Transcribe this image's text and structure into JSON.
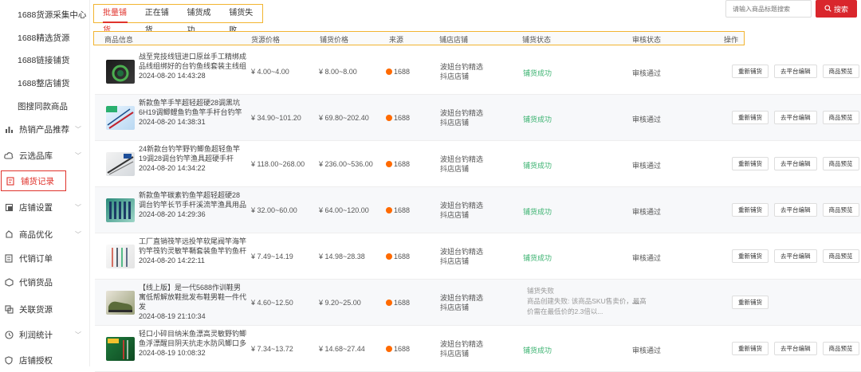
{
  "sidebar": {
    "sub_items": [
      {
        "label": "1688货源采集中心"
      },
      {
        "label": "1688精选货源"
      },
      {
        "label": "1688链接铺货"
      },
      {
        "label": "1688整店铺货"
      },
      {
        "label": "图搜同款商品"
      }
    ],
    "main_items": [
      {
        "label": "热销产品推荐",
        "icon": "bar-chart-icon",
        "chevron": true
      },
      {
        "label": "云选品库",
        "icon": "cloud-icon",
        "chevron": true
      },
      {
        "label": "铺货记录",
        "icon": "document-icon",
        "chevron": false,
        "active": true
      },
      {
        "label": "店铺设置",
        "icon": "store-icon",
        "chevron": true
      },
      {
        "label": "商品优化",
        "icon": "optimize-icon",
        "chevron": true
      },
      {
        "label": "代销订单",
        "icon": "order-icon",
        "chevron": false
      },
      {
        "label": "代销货品",
        "icon": "goods-icon",
        "chevron": false
      },
      {
        "label": "关联货源",
        "icon": "link-icon",
        "chevron": false
      },
      {
        "label": "利润统计",
        "icon": "clock-icon",
        "chevron": true
      },
      {
        "label": "店铺授权",
        "icon": "shield-icon",
        "chevron": false
      }
    ]
  },
  "tabs": [
    {
      "label": "批量铺货",
      "active": true
    },
    {
      "label": "正在铺货"
    },
    {
      "label": "铺货成功"
    },
    {
      "label": "铺货失败"
    }
  ],
  "search": {
    "placeholder": "请输入商品标题搜索",
    "button_label": "搜索"
  },
  "columns": [
    "商品信息",
    "货源价格",
    "铺货价格",
    "来源",
    "铺店店铺",
    "铺货状态",
    "审核状态",
    "操作"
  ],
  "buttons": {
    "republish": "重新铺货",
    "edit": "去平台编辑",
    "preview": "商品预览"
  },
  "rows": [
    {
      "title": "战至竞技线钮进口原丝手工精绑成品线组绑好的台钓鱼线套装主线组",
      "time": "2024-08-20 14:43:28",
      "source_price": "¥ 4.00~4.00",
      "list_price": "¥ 8.00~8.00",
      "source": "1688",
      "shop": "波妞台钓精选",
      "shop_type": "抖店店铺",
      "status": "铺货成功",
      "audit": "审核通过",
      "full_buttons": true
    },
    {
      "title": "新款鱼竿手竿超轻超硬28调黑坑6H19调鲫鲤鱼钓鱼竿手杆台钓竿",
      "time": "2024-08-20 14:38:31",
      "source_price": "¥ 34.90~101.20",
      "list_price": "¥ 69.80~202.40",
      "source": "1688",
      "shop": "波妞台钓精选",
      "shop_type": "抖店店铺",
      "status": "铺货成功",
      "audit": "审核通过",
      "full_buttons": true
    },
    {
      "title": "24新款台钓竿野钓鲫鱼超轻鱼竿19调28调台钓竿渔具超硬手杆",
      "time": "2024-08-20 14:34:22",
      "source_price": "¥ 118.00~268.00",
      "list_price": "¥ 236.00~536.00",
      "source": "1688",
      "shop": "波妞台钓精选",
      "shop_type": "抖店店铺",
      "status": "铺货成功",
      "audit": "审核通过",
      "full_buttons": true
    },
    {
      "title": "新款鱼竿碳素钓鱼竿超轻超硬28调台钓竿长节手杆溪流竿渔具用品",
      "time": "2024-08-20 14:29:36",
      "source_price": "¥ 32.00~60.00",
      "list_price": "¥ 64.00~120.00",
      "source": "1688",
      "shop": "波妞台钓精选",
      "shop_type": "抖店店铺",
      "status": "铺货成功",
      "audit": "审核通过",
      "full_buttons": true
    },
    {
      "title": "工厂直销筏竿远投竿软尾阀竿海竿钓竿筏钓灵敏竿鞘套装鱼竿钓鱼杆",
      "time": "2024-08-20 14:22:11",
      "source_price": "¥ 7.49~14.19",
      "list_price": "¥ 14.98~28.38",
      "source": "1688",
      "shop": "波妞台钓精选",
      "shop_type": "抖店店铺",
      "status": "铺货成功",
      "audit": "审核通过",
      "full_buttons": true
    },
    {
      "title": "【线上版】是一代5688作训鞋男寓低帮解放鞋批发布鞋男鞋一件代发",
      "time": "2024-08-19 21:10:34",
      "source_price": "¥ 4.60~12.50",
      "list_price": "¥ 9.20~25.00",
      "source": "1688",
      "shop": "波妞台钓精选",
      "shop_type": "抖店店铺",
      "status": "铺货失败",
      "status_detail": "商品创建失败: 该商品SKU售卖价，最高价需在最低价的2.3倍以...",
      "audit": "—",
      "full_buttons": false
    },
    {
      "title": "轻口小碎目纳米鱼漂高灵敏野钓鲫鱼浮漂醒目阴天抗走水防风鲫口多",
      "time": "2024-08-19 10:08:32",
      "source_price": "¥ 7.34~13.72",
      "list_price": "¥ 14.68~27.44",
      "source": "1688",
      "shop": "波妞台钓精选",
      "shop_type": "抖店店铺",
      "status": "铺货成功",
      "audit": "审核通过",
      "full_buttons": true
    }
  ]
}
